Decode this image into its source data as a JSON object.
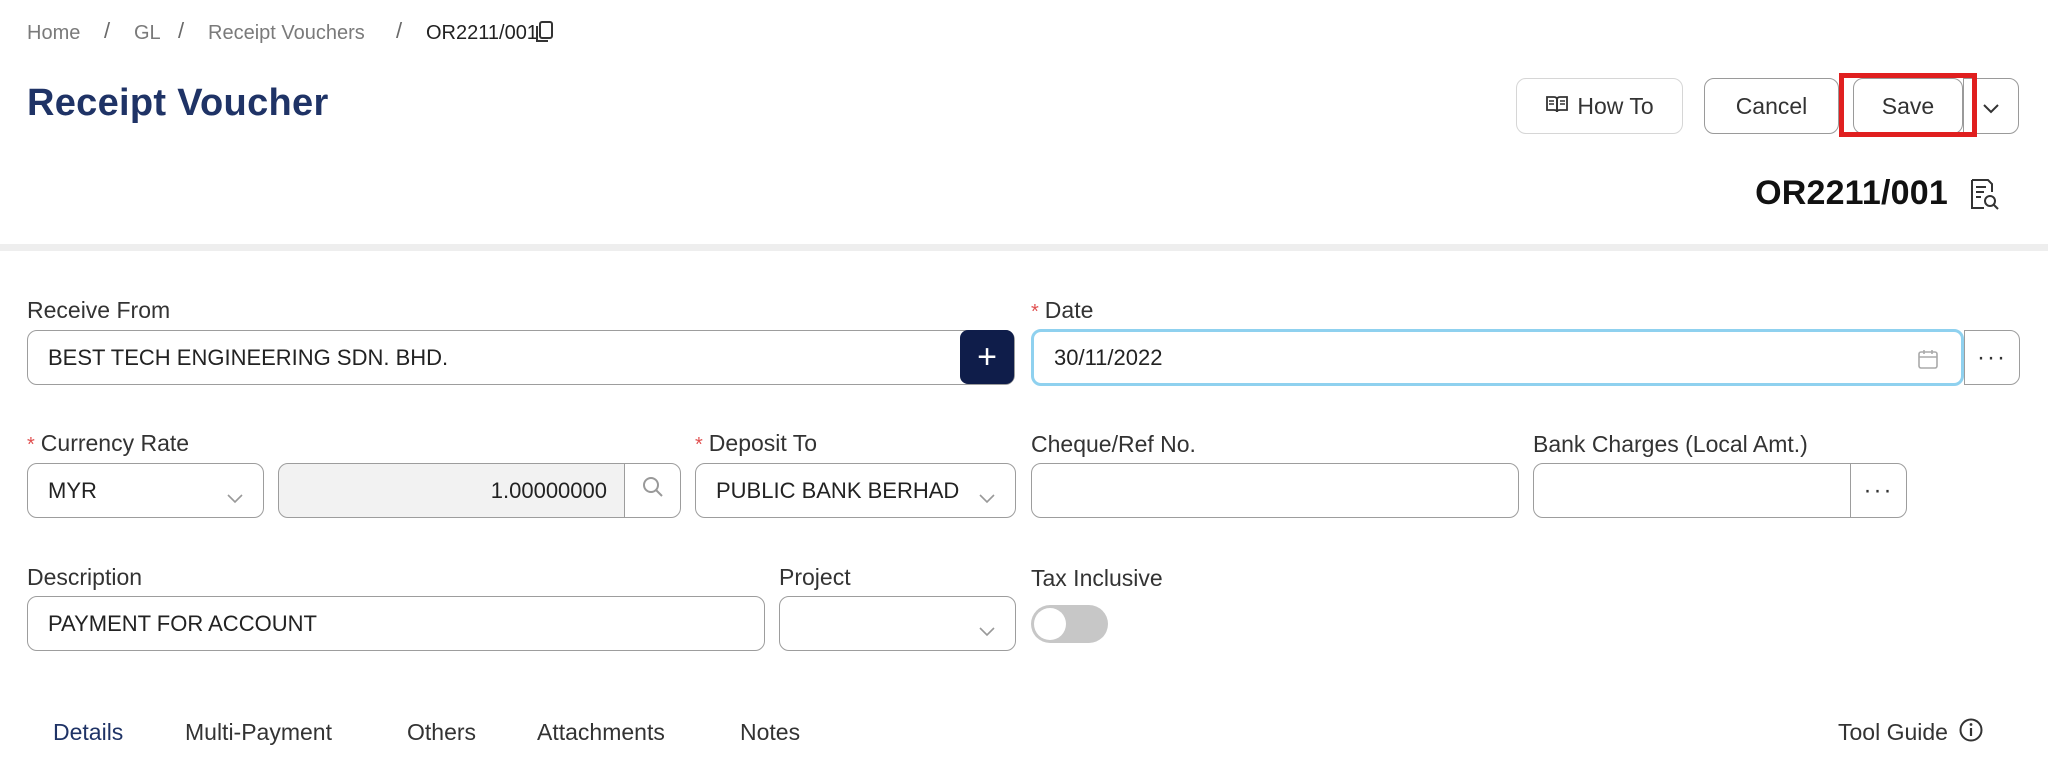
{
  "breadcrumb": {
    "home": "Home",
    "gl": "GL",
    "receipt_vouchers": "Receipt Vouchers",
    "current": "OR2211/001"
  },
  "page_title": "Receipt Voucher",
  "actions": {
    "how_to": "How To",
    "cancel": "Cancel",
    "save": "Save"
  },
  "document_number": "OR2211/001",
  "form": {
    "receive_from": {
      "label": "Receive From",
      "value": "BEST TECH ENGINEERING SDN. BHD."
    },
    "date": {
      "label": "Date",
      "value": "30/11/2022"
    },
    "currency_rate": {
      "label": "Currency Rate",
      "currency": "MYR",
      "rate": "1.00000000"
    },
    "deposit_to": {
      "label": "Deposit To",
      "value": "PUBLIC BANK BERHAD"
    },
    "cheque_ref": {
      "label": "Cheque/Ref No.",
      "value": ""
    },
    "bank_charges": {
      "label": "Bank Charges (Local Amt.)",
      "value": ""
    },
    "description": {
      "label": "Description",
      "value": "PAYMENT FOR ACCOUNT"
    },
    "project": {
      "label": "Project",
      "value": ""
    },
    "tax_inclusive": {
      "label": "Tax Inclusive",
      "on": false
    }
  },
  "tabs": [
    "Details",
    "Multi-Payment",
    "Others",
    "Attachments",
    "Notes"
  ],
  "tool_guide": "Tool Guide",
  "colors": {
    "accent": "#1f3366",
    "highlight": "#e01f1f",
    "focus": "#8fd1ef",
    "add_button": "#0f1d4a"
  }
}
